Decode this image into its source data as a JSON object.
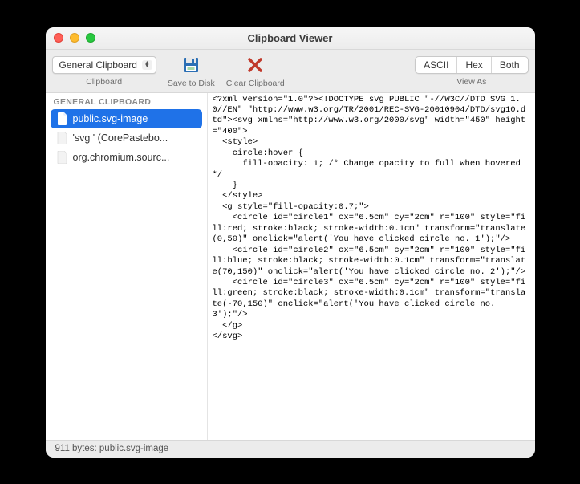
{
  "window": {
    "title": "Clipboard Viewer"
  },
  "toolbar": {
    "dropdown": {
      "selected": "General Clipboard",
      "label": "Clipboard"
    },
    "save": {
      "label": "Save to Disk"
    },
    "clear": {
      "label": "Clear Clipboard"
    },
    "viewAs": {
      "label": "View As",
      "options": {
        "ascii": "ASCII",
        "hex": "Hex",
        "both": "Both"
      }
    }
  },
  "sidebar": {
    "header": "GENERAL CLIPBOARD",
    "items": [
      {
        "label": "public.svg-image",
        "selected": true
      },
      {
        "label": "'svg ' (CorePastebo...",
        "selected": false
      },
      {
        "label": "org.chromium.sourc...",
        "selected": false
      }
    ]
  },
  "content": {
    "text": "<?xml version=\"1.0\"?><!DOCTYPE svg PUBLIC \"-//W3C//DTD SVG 1.0//EN\" \"http://www.w3.org/TR/2001/REC-SVG-20010904/DTD/svg10.dtd\"><svg xmlns=\"http://www.w3.org/2000/svg\" width=\"450\" height=\"400\">\n  <style>\n    circle:hover {\n      fill-opacity: 1; /* Change opacity to full when hovered */\n    }\n  </style>\n  <g style=\"fill-opacity:0.7;\">\n    <circle id=\"circle1\" cx=\"6.5cm\" cy=\"2cm\" r=\"100\" style=\"fill:red; stroke:black; stroke-width:0.1cm\" transform=\"translate(0,50)\" onclick=\"alert('You have clicked circle no. 1');\"/>\n    <circle id=\"circle2\" cx=\"6.5cm\" cy=\"2cm\" r=\"100\" style=\"fill:blue; stroke:black; stroke-width:0.1cm\" transform=\"translate(70,150)\" onclick=\"alert('You have clicked circle no. 2');\"/>\n    <circle id=\"circle3\" cx=\"6.5cm\" cy=\"2cm\" r=\"100\" style=\"fill:green; stroke:black; stroke-width:0.1cm\" transform=\"translate(-70,150)\" onclick=\"alert('You have clicked circle no. 3');\"/>\n  </g>\n</svg>"
  },
  "statusbar": {
    "text": "911 bytes: public.svg-image"
  }
}
